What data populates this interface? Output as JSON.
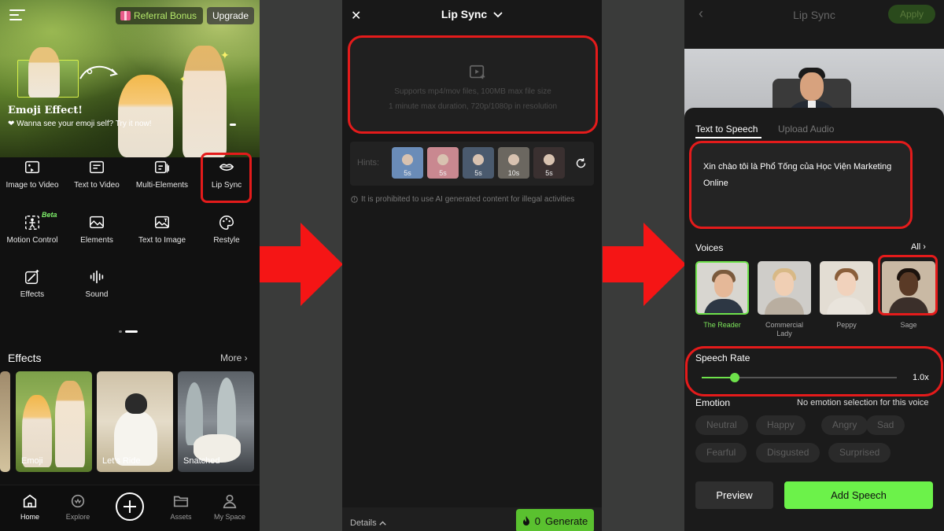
{
  "panel1": {
    "header": {
      "referral_label": "Referral Bonus",
      "upgrade_label": "Upgrade"
    },
    "hero": {
      "title": "Emoji Effect!",
      "subtitle": "❤ Wanna see your emoji self? Try it now!"
    },
    "tools": [
      {
        "label": "Image to Video",
        "icon": "image-video-icon"
      },
      {
        "label": "Text to Video",
        "icon": "text-video-icon"
      },
      {
        "label": "Multi-Elements",
        "icon": "multi-elements-icon"
      },
      {
        "label": "Lip Sync",
        "icon": "lips-icon"
      },
      {
        "label": "Motion Control",
        "icon": "motion-control-icon",
        "badge": "Beta"
      },
      {
        "label": "Elements",
        "icon": "elements-icon"
      },
      {
        "label": "Text to Image",
        "icon": "text-image-icon"
      },
      {
        "label": "Restyle",
        "icon": "palette-icon"
      },
      {
        "label": "Effects",
        "icon": "wand-icon"
      },
      {
        "label": "Sound",
        "icon": "soundwave-icon"
      }
    ],
    "effects_section": {
      "title": "Effects",
      "more_label": "More"
    },
    "effect_cards": [
      {
        "label": "Emoji"
      },
      {
        "label": "Let's Ride"
      },
      {
        "label": "Snatched"
      }
    ],
    "nav": [
      {
        "label": "Home",
        "icon": "home-icon",
        "active": true
      },
      {
        "label": "Explore",
        "icon": "explore-icon",
        "active": false
      },
      {
        "label": "Assets",
        "icon": "folder-icon",
        "active": false
      },
      {
        "label": "My Space",
        "icon": "user-icon",
        "active": false
      }
    ]
  },
  "panel2": {
    "title": "Lip Sync",
    "upload": {
      "line1": "Supports mp4/mov files, 100MB max file size",
      "line2": "1 minute max duration, 720p/1080p in resolution"
    },
    "hints": {
      "label": "Hints:",
      "items": [
        {
          "duration": "5s",
          "color": "#6a8cb8"
        },
        {
          "duration": "5s",
          "color": "#c98890"
        },
        {
          "duration": "5s",
          "color": "#4a5a6e"
        },
        {
          "duration": "10s",
          "color": "#6b6760"
        },
        {
          "duration": "5s",
          "color": "#3a3030"
        }
      ]
    },
    "warning": "It is prohibited to use AI generated content for illegal activities",
    "footer": {
      "details_label": "Details",
      "credits": "0",
      "generate_label": "Generate"
    }
  },
  "panel3": {
    "title": "Lip Sync",
    "apply_label": "Apply",
    "tabs": {
      "tts": "Text to Speech",
      "upload": "Upload Audio"
    },
    "text_content": "Xin chào tôi là Phổ Tống của Học Viện Marketing Online",
    "voices_label": "Voices",
    "voices_all": "All",
    "voices": [
      {
        "name": "The Reader",
        "selected": true,
        "bg": "#d8d6d0",
        "skin": "#e5b898",
        "hair": "#7a5a3c",
        "suit": "#2d3744"
      },
      {
        "name": "Commercial Lady",
        "selected": false,
        "bg": "#cfcdc9",
        "skin": "#f0cfb4",
        "hair": "#d8b986",
        "suit": "#b9aea0"
      },
      {
        "name": "Peppy",
        "selected": false,
        "bg": "#e3ddd3",
        "skin": "#f1d2bc",
        "hair": "#8a5e3a",
        "suit": "#e9e4dc"
      },
      {
        "name": "Sage",
        "selected": false,
        "bg": "#c9b9a4",
        "skin": "#5a3a26",
        "hair": "#1c130d",
        "suit": "#3b2f2a"
      }
    ],
    "speech_rate": {
      "label": "Speech Rate",
      "value": "1.0x",
      "fraction": 0.17
    },
    "emotion": {
      "label": "Emotion",
      "note": "No emotion selection for this voice",
      "options": [
        "Neutral",
        "Happy",
        "Angry",
        "Sad",
        "Fearful",
        "Disgusted",
        "Surprised"
      ]
    },
    "preview_label": "Preview",
    "add_label": "Add Speech"
  },
  "colors": {
    "accent_green": "#6cf24a",
    "highlight_red": "#e41b1b"
  }
}
